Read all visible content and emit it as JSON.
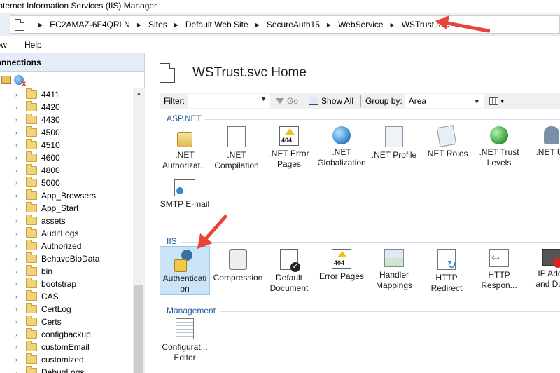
{
  "window": {
    "title": "Internet Information Services (IIS) Manager"
  },
  "address": {
    "crumbs": [
      "EC2AMAZ-6F4QRLN",
      "Sites",
      "Default Web Site",
      "SecureAuth15",
      "WebService",
      "WSTrust.svc"
    ]
  },
  "menu": {
    "items": [
      "View",
      "Help"
    ]
  },
  "connections": {
    "header": "Connections",
    "tree": [
      "4411",
      "4420",
      "4430",
      "4500",
      "4510",
      "4600",
      "4800",
      "5000",
      "App_Browsers",
      "App_Start",
      "assets",
      "AuditLogs",
      "Authorized",
      "BehaveBioData",
      "bin",
      "bootstrap",
      "CAS",
      "CertLog",
      "Certs",
      "configbackup",
      "customEmail",
      "customized",
      "DebugLogs"
    ]
  },
  "home": {
    "title": "WSTrust.svc Home"
  },
  "filter": {
    "label": "Filter:",
    "value": "",
    "go": "Go",
    "show_all": "Show All",
    "group_by_label": "Group by:",
    "group_by_value": "Area"
  },
  "sections": {
    "aspnet": "ASP.NET",
    "iis": "IIS",
    "management": "Management"
  },
  "aspnet_tiles": [
    {
      "l1": ".NET",
      "l2": "Authorizat...",
      "icon": "lock-icon"
    },
    {
      "l1": ".NET",
      "l2": "Compilation",
      "icon": "download-icon"
    },
    {
      "l1": ".NET Error",
      "l2": "Pages",
      "icon": "error-page-icon"
    },
    {
      "l1": ".NET",
      "l2": "Globalization",
      "icon": "globe-icon"
    },
    {
      "l1": ".NET Profile",
      "l2": "",
      "icon": "profile-icon"
    },
    {
      "l1": ".NET Roles",
      "l2": "",
      "icon": "roles-icon"
    },
    {
      "l1": ".NET Trust",
      "l2": "Levels",
      "icon": "trust-icon"
    },
    {
      "l1": ".NET Us",
      "l2": "",
      "icon": "users-icon"
    },
    {
      "l1": "SMTP E-mail",
      "l2": "",
      "icon": "smtp-icon"
    }
  ],
  "iis_tiles": [
    {
      "l1": "Authenticati",
      "l2": "on",
      "icon": "authentication-icon"
    },
    {
      "l1": "Compression",
      "l2": "",
      "icon": "compression-icon"
    },
    {
      "l1": "Default",
      "l2": "Document",
      "icon": "default-document-icon"
    },
    {
      "l1": "Error Pages",
      "l2": "",
      "icon": "error-pages-icon"
    },
    {
      "l1": "Handler",
      "l2": "Mappings",
      "icon": "handler-mappings-icon"
    },
    {
      "l1": "HTTP",
      "l2": "Redirect",
      "icon": "http-redirect-icon"
    },
    {
      "l1": "HTTP",
      "l2": "Respon...",
      "icon": "http-response-icon"
    },
    {
      "l1": "IP Addr",
      "l2": "and Don",
      "icon": "ip-restrictions-icon"
    }
  ],
  "management_tiles": [
    {
      "l1": "Configurat...",
      "l2": "Editor",
      "icon": "config-editor-icon"
    }
  ],
  "annotation_color": "#e8443a"
}
